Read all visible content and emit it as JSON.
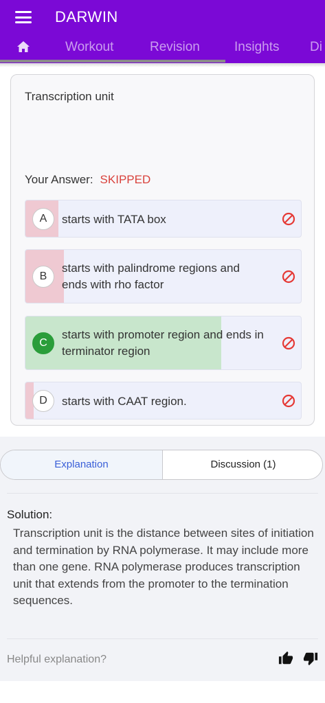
{
  "app": {
    "title": "DARWIN"
  },
  "tabs": {
    "home_icon": "home-icon",
    "items": [
      "Workout",
      "Revision",
      "Insights",
      "Di"
    ]
  },
  "question": {
    "text": "Transcription unit",
    "answer_label": "Your Answer:",
    "answer_status": "SKIPPED",
    "options": [
      {
        "letter": "A",
        "text": "starts with TATA box",
        "response_fraction": 0.12,
        "correct": false
      },
      {
        "letter": "B",
        "text": "starts with palindrome regions and ends with rho factor",
        "response_fraction": 0.14,
        "correct": false
      },
      {
        "letter": "C",
        "text": "starts with promoter region and ends in terminator region",
        "response_fraction": 0.71,
        "correct": true
      },
      {
        "letter": "D",
        "text": "starts with CAAT region.",
        "response_fraction": 0.03,
        "correct": false
      }
    ],
    "status_icon": "ban-icon"
  },
  "segments": {
    "explanation": "Explanation",
    "discussion": "Discussion (1)"
  },
  "solution": {
    "label": "Solution:",
    "text": "Transcription unit is the distance between sites of initiation and termination by RNA polymerase. It may include more than one gene. RNA polymerase produces transcription unit that extends from the promoter to the termination sequences."
  },
  "feedback": {
    "prompt": "Helpful explanation?",
    "up_icon": "thumbs-up-icon",
    "down_icon": "thumbs-down-icon"
  },
  "colors": {
    "appbar": "#7b09d6",
    "wrong_fill": "#efc9d2",
    "correct_fill": "#c8e6cc",
    "skipped": "#d9423c",
    "correct_badge": "#2a9d3a"
  }
}
